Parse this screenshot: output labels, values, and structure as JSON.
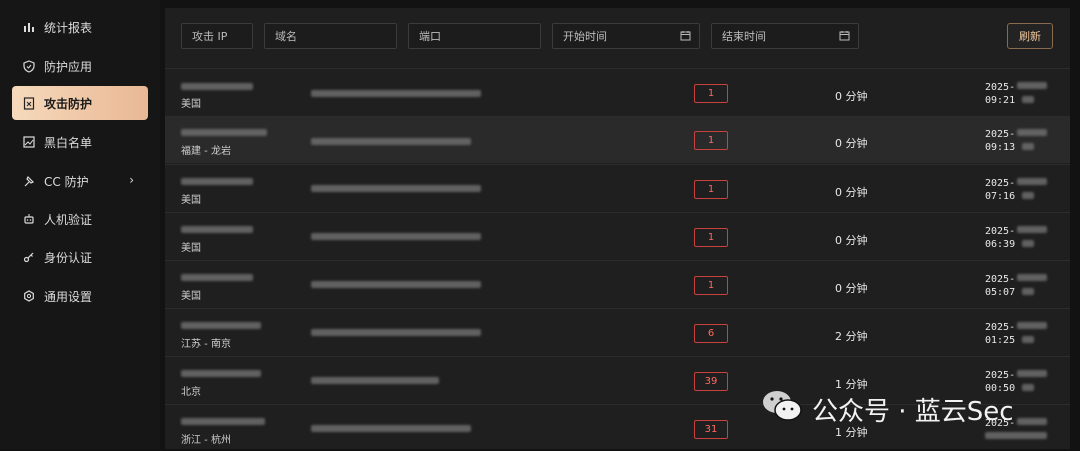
{
  "sidebar": {
    "items": [
      {
        "label": "统计报表",
        "icon": "bar-chart-icon"
      },
      {
        "label": "防护应用",
        "icon": "shield-icon"
      },
      {
        "label": "攻击防护",
        "icon": "attack-doc-icon"
      },
      {
        "label": "黑白名单",
        "icon": "list-image-icon"
      },
      {
        "label": "CC 防护",
        "icon": "pin-icon"
      },
      {
        "label": "人机验证",
        "icon": "robot-icon"
      },
      {
        "label": "身份认证",
        "icon": "key-icon"
      },
      {
        "label": "通用设置",
        "icon": "gear-icon"
      }
    ]
  },
  "filters": {
    "ip_placeholder": "攻击 IP",
    "domain_placeholder": "域名",
    "port_placeholder": "端口",
    "start_placeholder": "开始时间",
    "end_placeholder": "结束时间",
    "refresh_label": "刷新"
  },
  "rows": [
    {
      "location": "美国",
      "count": "1",
      "duration": "0 分钟",
      "time1": "2025-",
      "time2": "09:21"
    },
    {
      "location": "福建 - 龙岩",
      "count": "1",
      "duration": "0 分钟",
      "time1": "2025-",
      "time2": "09:13"
    },
    {
      "location": "美国",
      "count": "1",
      "duration": "0 分钟",
      "time1": "2025-",
      "time2": "07:16"
    },
    {
      "location": "美国",
      "count": "1",
      "duration": "0 分钟",
      "time1": "2025-",
      "time2": "06:39"
    },
    {
      "location": "美国",
      "count": "1",
      "duration": "0 分钟",
      "time1": "2025-",
      "time2": "05:07"
    },
    {
      "location": "江苏 - 南京",
      "count": "6",
      "duration": "2 分钟",
      "time1": "2025-",
      "time2": "01:25"
    },
    {
      "location": "北京",
      "count": "39",
      "duration": "1 分钟",
      "time1": "2025-",
      "time2": "00:50"
    },
    {
      "location": "浙江 - 杭州",
      "count": "31",
      "duration": "1 分钟",
      "time1": "2025-",
      "time2": ""
    }
  ],
  "watermark": "公众号 · 蓝云Sec",
  "colors": {
    "accent": "#e9b894",
    "badge": "#c8413d"
  }
}
